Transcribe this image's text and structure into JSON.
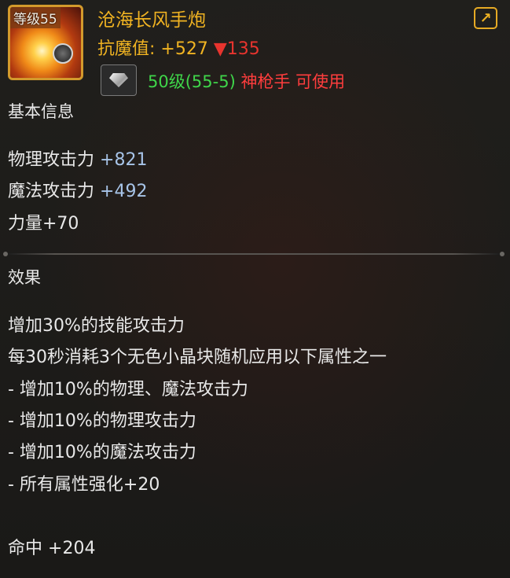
{
  "item": {
    "level_badge": "等级55",
    "name": "沧海长风手炮",
    "anti_magic_label": "抗魔值:",
    "anti_magic_value": "+527",
    "anti_magic_change": "▼135",
    "requirement_level": "50级(55-5)",
    "requirement_class": "神枪手 可使用"
  },
  "basic_info": {
    "title": "基本信息",
    "physical_attack_label": "物理攻击力",
    "physical_attack_value": "+821",
    "magic_attack_label": "魔法攻击力",
    "magic_attack_value": "+492",
    "strength": "力量+70"
  },
  "effects": {
    "title": "效果",
    "lines": [
      "增加30%的技能攻击力",
      "每30秒消耗3个无色小晶块随机应用以下属性之一",
      "- 增加10%的物理、魔法攻击力",
      "- 增加10%的物理攻击力",
      "- 增加10%的魔法攻击力",
      "- 所有属性强化+20"
    ],
    "hit_label": "命中",
    "hit_value": "+204"
  },
  "icons": {
    "share": "share-icon",
    "gem": "diamond-icon"
  },
  "colors": {
    "gold": "#f0b322",
    "red": "#e8342e",
    "green": "#3fd64a",
    "blue": "#a7c4e8"
  }
}
